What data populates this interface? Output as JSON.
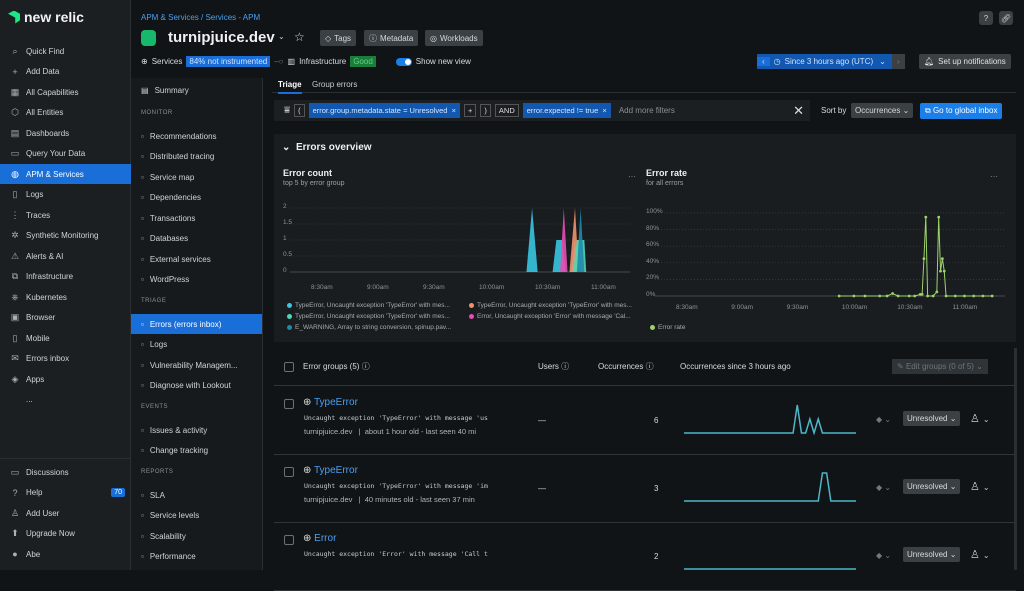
{
  "nav": {
    "logo": "new relic",
    "items": [
      {
        "icon": "search-icon",
        "glyph": "⌕",
        "label": "Quick Find"
      },
      {
        "icon": "plus-icon",
        "glyph": "+",
        "label": "Add Data"
      },
      {
        "icon": "grid-icon",
        "glyph": "▦",
        "label": "All Capabilities"
      },
      {
        "icon": "entities-icon",
        "glyph": "⬡",
        "label": "All Entities"
      },
      {
        "icon": "dashboard-icon",
        "glyph": "▤",
        "label": "Dashboards"
      },
      {
        "icon": "query-icon",
        "glyph": "▭",
        "label": "Query Your Data"
      },
      {
        "icon": "apm-icon",
        "glyph": "◍",
        "label": "APM & Services",
        "active": true
      },
      {
        "icon": "logs-icon",
        "glyph": "▯",
        "label": "Logs"
      },
      {
        "icon": "traces-icon",
        "glyph": "⋮",
        "label": "Traces"
      },
      {
        "icon": "synthetic-icon",
        "glyph": "✲",
        "label": "Synthetic Monitoring"
      },
      {
        "icon": "alert-icon",
        "glyph": "⚠",
        "label": "Alerts & AI"
      },
      {
        "icon": "infrastructure-icon",
        "glyph": "⧉",
        "label": "Infrastructure"
      },
      {
        "icon": "kubernetes-icon",
        "glyph": "⎈",
        "label": "Kubernetes"
      },
      {
        "icon": "browser-icon",
        "glyph": "▣",
        "label": "Browser"
      },
      {
        "icon": "mobile-icon",
        "glyph": "▯",
        "label": "Mobile"
      },
      {
        "icon": "inbox-icon",
        "glyph": "✉",
        "label": "Errors inbox"
      },
      {
        "icon": "apps-icon",
        "glyph": "◈",
        "label": "Apps"
      },
      {
        "icon": "more-icon",
        "glyph": "",
        "label": "..."
      }
    ],
    "bottom": [
      {
        "icon": "discussions-icon",
        "glyph": "▭",
        "label": "Discussions"
      },
      {
        "icon": "help-icon",
        "glyph": "?",
        "label": "Help",
        "badge": "70"
      },
      {
        "icon": "add-user-icon",
        "glyph": "♙",
        "label": "Add User"
      },
      {
        "icon": "upgrade-icon",
        "glyph": "⬆",
        "label": "Upgrade Now"
      },
      {
        "icon": "avatar",
        "glyph": "●",
        "label": "Abe"
      }
    ]
  },
  "header": {
    "breadcrumb": "APM & Services / Services - APM",
    "title": "turnipjuice.dev",
    "tags": "Tags",
    "metadata": "Metadata",
    "workloads": "Workloads",
    "services_label": "Services",
    "services_badge": "84% not instrumented",
    "infra_label": "Infrastructure",
    "infra_badge": "Good",
    "new_view": "Show new view",
    "time_range": "Since 3 hours ago (UTC)",
    "notifications": "Set up notifications"
  },
  "subnav": {
    "summary": "Summary",
    "sections": [
      {
        "title": "MONITOR",
        "items": [
          "Recommendations",
          "Distributed tracing",
          "Service map",
          "Dependencies",
          "Transactions",
          "Databases",
          "External services",
          "WordPress"
        ]
      },
      {
        "title": "TRIAGE",
        "items": [
          "Errors (errors inbox)",
          "Logs",
          "Vulnerability Managem...",
          "Diagnose with Lookout"
        ]
      },
      {
        "title": "EVENTS",
        "items": [
          "Issues & activity",
          "Change tracking"
        ]
      },
      {
        "title": "REPORTS",
        "items": [
          "SLA",
          "Service levels",
          "Scalability",
          "Performance"
        ]
      }
    ]
  },
  "tabs": [
    "Triage",
    "Group errors"
  ],
  "filters": {
    "f1": "error.group.metadata.state  =  Unresolved",
    "plus": "+",
    "and": "AND",
    "f2": "error.expected  !=  true",
    "placeholder": "Add more filters",
    "sort_label": "Sort by",
    "sort_value": "Occurrences",
    "global_inbox": "Go to global inbox"
  },
  "overview": {
    "title": "Errors overview"
  },
  "chart_data": [
    {
      "type": "area",
      "title": "Error count",
      "subtitle": "top 5 by error group",
      "ylim": [
        0,
        2
      ],
      "yticks": [
        "0",
        "0.5",
        "1",
        "1.5",
        "2"
      ],
      "xticks": [
        "8:30am",
        "9:00am",
        "9:30am",
        "10:00am",
        "10:30am",
        "11:00am"
      ],
      "grid": true,
      "series": [
        {
          "name": "TypeError, Uncaught exception 'TypeError' with mes...",
          "color": "#38c6e0",
          "points": [
            [
              "10:19",
              0
            ],
            [
              "10:22",
              2
            ],
            [
              "10:25",
              0
            ],
            [
              "10:33",
              0
            ],
            [
              "10:35",
              1
            ],
            [
              "10:38",
              1
            ],
            [
              "10:40",
              0
            ],
            [
              "10:43",
              0
            ],
            [
              "10:45",
              1
            ],
            [
              "10:47",
              0
            ]
          ]
        },
        {
          "name": "TypeError, Uncaught exception 'TypeError' with mes...",
          "color": "#f0936a",
          "points": [
            [
              "10:42",
              0
            ],
            [
              "10:45",
              2
            ],
            [
              "10:46",
              1
            ],
            [
              "10:49",
              1
            ],
            [
              "10:50",
              0
            ]
          ]
        },
        {
          "name": "TypeError, Uncaught exception 'TypeError' with mes...",
          "color": "#4fd6b8",
          "points": [
            [
              "10:44",
              0
            ],
            [
              "10:46",
              1
            ],
            [
              "10:50",
              1
            ],
            [
              "10:51",
              0
            ]
          ]
        },
        {
          "name": "Error, Uncaught exception 'Error' with message 'Cal...",
          "color": "#e44fb0",
          "points": [
            [
              "10:37",
              0
            ],
            [
              "10:39",
              2
            ],
            [
              "10:41",
              0
            ]
          ]
        },
        {
          "name": "E_WARNING, Array to string conversion, spinup.pav...",
          "color": "#1f8aa8",
          "points": [
            [
              "10:46",
              0
            ],
            [
              "10:48",
              2
            ],
            [
              "10:50",
              0
            ]
          ]
        }
      ]
    },
    {
      "type": "line",
      "title": "Error rate",
      "subtitle": "for all errors",
      "ylim": [
        0,
        100
      ],
      "yticks": [
        "0%",
        "20%",
        "40%",
        "60%",
        "80%",
        "100%"
      ],
      "xticks": [
        "8:30am",
        "9:00am",
        "9:30am",
        "10:00am",
        "10:30am",
        "11:00am"
      ],
      "grid": true,
      "series": [
        {
          "name": "Error rate",
          "color": "#9ed36a",
          "points": [
            [
              "9:52",
              0
            ],
            [
              "10:00",
              0
            ],
            [
              "10:06",
              0
            ],
            [
              "10:14",
              0
            ],
            [
              "10:18",
              0
            ],
            [
              "10:21",
              3
            ],
            [
              "10:24",
              0
            ],
            [
              "10:30",
              0
            ],
            [
              "10:33",
              0
            ],
            [
              "10:36",
              2
            ],
            [
              "10:37",
              2
            ],
            [
              "10:38",
              45
            ],
            [
              "10:39",
              95
            ],
            [
              "10:40",
              0
            ],
            [
              "10:43",
              0
            ],
            [
              "10:45",
              5
            ],
            [
              "10:46",
              95
            ],
            [
              "10:47",
              30
            ],
            [
              "10:48",
              45
            ],
            [
              "10:49",
              30
            ],
            [
              "10:50",
              0
            ],
            [
              "10:55",
              0
            ],
            [
              "11:00",
              0
            ],
            [
              "11:05",
              0
            ],
            [
              "11:10",
              0
            ],
            [
              "11:15",
              0
            ]
          ]
        }
      ]
    }
  ],
  "table": {
    "header": {
      "groups": "Error groups (5)",
      "users": "Users",
      "occurrences": "Occurrences",
      "since": "Occurrences since 3 hours ago",
      "edit": "Edit groups (0 of 5)"
    },
    "rows": [
      {
        "name": "TypeError",
        "message": "Uncaught exception 'TypeError' with message 'us",
        "entity": "turnipjuice.dev",
        "age": "about 1 hour old - last seen 40 mi",
        "users": "—",
        "occurrences": "6",
        "status": "Unresolved",
        "spark": [
          0,
          0,
          0,
          0,
          0,
          0,
          0,
          0,
          0,
          0,
          0,
          0,
          0,
          0,
          0,
          0,
          0,
          0,
          0,
          0,
          0,
          0,
          0,
          0,
          0,
          0,
          0,
          2,
          0,
          0,
          1,
          0,
          1,
          0,
          0,
          0,
          0,
          0,
          0,
          0,
          0,
          0
        ]
      },
      {
        "name": "TypeError",
        "message": "Uncaught exception 'TypeError' with message 'im",
        "entity": "turnipjuice.dev",
        "age": "40 minutes old - last seen 37 min",
        "users": "—",
        "occurrences": "3",
        "status": "Unresolved",
        "spark": [
          0,
          0,
          0,
          0,
          0,
          0,
          0,
          0,
          0,
          0,
          0,
          0,
          0,
          0,
          0,
          0,
          0,
          0,
          0,
          0,
          0,
          0,
          0,
          0,
          0,
          0,
          0,
          0,
          0,
          0,
          0,
          0,
          0,
          2,
          2,
          0,
          0,
          0,
          0,
          0,
          0,
          0
        ]
      },
      {
        "name": "Error",
        "message": "Uncaught exception 'Error' with message 'Call t",
        "entity": "",
        "age": "",
        "users": "",
        "occurrences": "2",
        "status": "Unresolved",
        "spark": [
          0,
          0,
          0,
          0,
          0,
          0,
          0,
          0,
          0,
          0,
          0,
          0,
          0,
          0,
          0,
          0,
          0,
          0,
          0,
          0,
          0,
          0,
          0,
          0,
          0,
          0,
          0,
          0,
          0,
          0,
          0,
          0,
          0,
          0,
          0,
          0,
          0,
          0,
          0,
          0,
          0,
          0
        ]
      }
    ]
  },
  "colors": {
    "accent": "#1a6ed8",
    "link": "#4c9ff0",
    "good": "#1a7d3a"
  }
}
